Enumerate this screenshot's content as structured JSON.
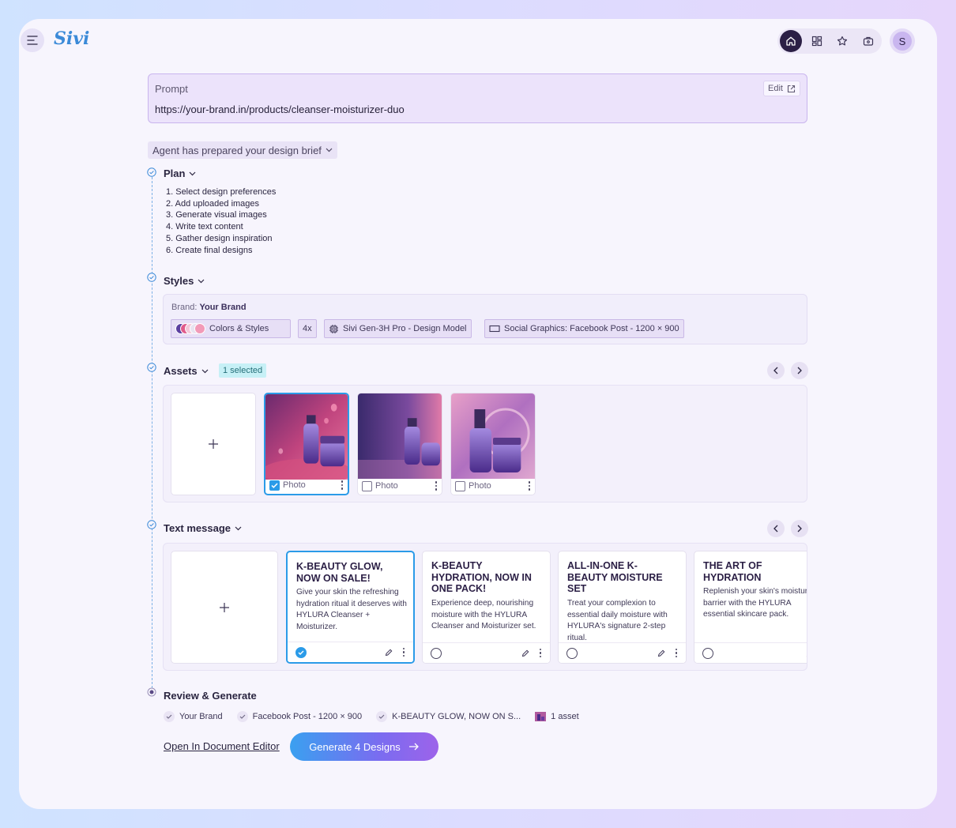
{
  "app": {
    "logo": "Sivi",
    "avatar_initial": "S"
  },
  "topnav": {
    "icons": [
      "home-icon",
      "dashboard-icon",
      "star-icon",
      "briefcase-icon"
    ],
    "active": "home-icon"
  },
  "prompt": {
    "label": "Prompt",
    "value": "https://your-brand.in/products/cleanser-moisturizer-duo",
    "edit_label": "Edit"
  },
  "brief": {
    "label": "Agent has prepared your design brief"
  },
  "plan": {
    "title": "Plan",
    "items": [
      "1. Select design preferences",
      "2. Add uploaded images",
      "3. Generate visual images",
      "4. Write text content",
      "5. Gather design inspiration",
      "6. Create final designs"
    ]
  },
  "styles": {
    "title": "Styles",
    "brand_prefix": "Brand: ",
    "brand_name": "Your Brand",
    "colors_label": "Colors & Styles",
    "swatches": [
      "#5b3fa0",
      "#e05a8a",
      "#f4c6d8",
      "#e8e3f0",
      "#f29ab8"
    ],
    "count": "4x",
    "model": "Sivi Gen-3H Pro - Design Model",
    "format": "Social Graphics: Facebook Post - 1200 × 900"
  },
  "assets": {
    "title": "Assets",
    "badge": "1 selected",
    "items": [
      {
        "label": "Photo",
        "selected": true
      },
      {
        "label": "Photo",
        "selected": false
      },
      {
        "label": "Photo",
        "selected": false
      }
    ]
  },
  "text_message": {
    "title": "Text message",
    "items": [
      {
        "heading": "K-BEAUTY GLOW, NOW ON SALE!",
        "body": "Give your skin the refreshing hydration ritual it deserves with HYLURA Cleanser + Moisturizer.",
        "selected": true
      },
      {
        "heading": "K-BEAUTY HYDRATION, NOW IN ONE PACK!",
        "body": "Experience deep, nourishing moisture with the HYLURA Cleanser and Moisturizer set.",
        "selected": false
      },
      {
        "heading": "ALL-IN-ONE K-BEAUTY MOISTURE SET",
        "body": "Treat your complexion to essential daily moisture with HYLURA's signature 2-step ritual.",
        "selected": false
      },
      {
        "heading": "THE ART OF HYDRATION",
        "body": "Replenish your skin's moisture barrier with the HYLURA essential skincare pack.",
        "selected": false
      }
    ]
  },
  "review": {
    "title": "Review & Generate",
    "items": [
      "Your Brand",
      "Facebook Post - 1200 × 900",
      "K-BEAUTY GLOW, NOW ON S..."
    ],
    "asset_summary": "1 asset",
    "open_editor": "Open In Document Editor",
    "generate": "Generate 4 Designs"
  },
  "colors": {
    "accent": "#2b9be8",
    "primary_dark": "#2b1f45",
    "surface": "#f7f5fd"
  }
}
